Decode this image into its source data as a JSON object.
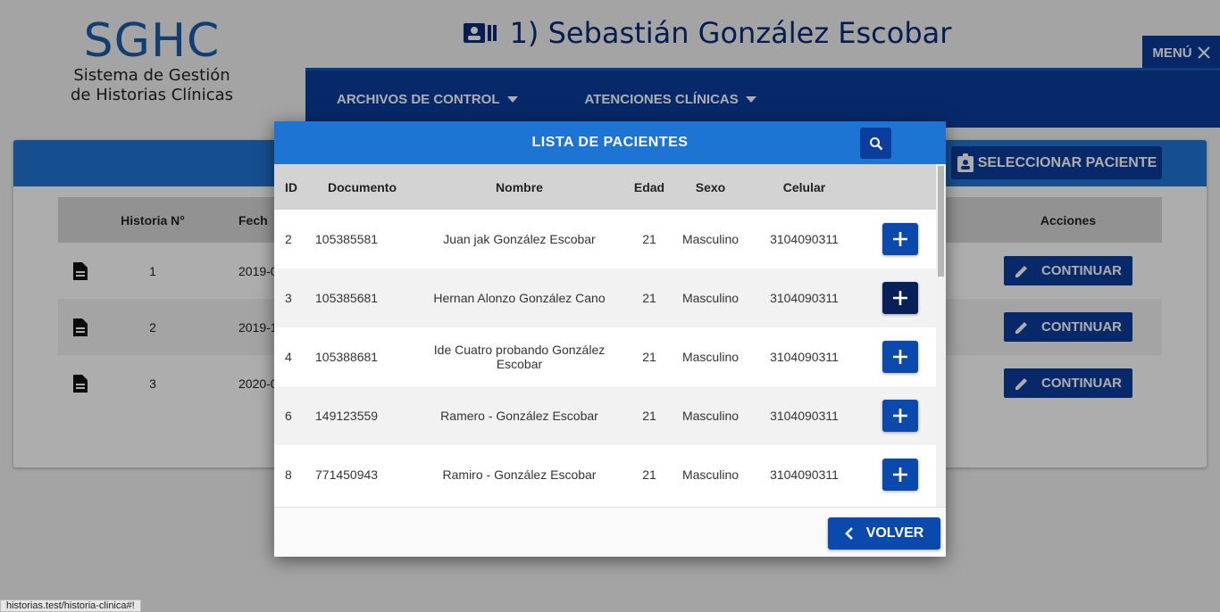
{
  "logo": {
    "title": "SGHC",
    "subtitle_line1": "Sistema de Gestión",
    "subtitle_line2": "de Historias Clínicas"
  },
  "patient_header": {
    "title": "1) Sebastián González Escobar"
  },
  "menu": {
    "label": "MENÚ"
  },
  "nav": {
    "items": [
      {
        "label": "ARCHIVOS DE CONTROL"
      },
      {
        "label": "ATENCIONES CLÍNICAS"
      }
    ]
  },
  "background_card": {
    "select_patient_label": "SELECCIONAR PACIENTE",
    "columns": {
      "historia": "Historia N°",
      "fecha": "Fech",
      "acciones": "Acciones"
    },
    "rows": [
      {
        "historia": "1",
        "fecha": "2019-0",
        "action": "CONTINUAR"
      },
      {
        "historia": "2",
        "fecha": "2019-1",
        "action": "CONTINUAR"
      },
      {
        "historia": "3",
        "fecha": "2020-0",
        "action": "CONTINUAR"
      }
    ]
  },
  "modal": {
    "title": "LISTA DE PACIENTES",
    "columns": {
      "id": "ID",
      "documento": "Documento",
      "nombre": "Nombre",
      "edad": "Edad",
      "sexo": "Sexo",
      "celular": "Celular"
    },
    "rows": [
      {
        "id": "2",
        "documento": "105385581",
        "nombre": "Juan jak González Escobar",
        "edad": "21",
        "sexo": "Masculino",
        "celular": "3104090311"
      },
      {
        "id": "3",
        "documento": "105385681",
        "nombre": "Hernan Alonzo González Cano",
        "edad": "21",
        "sexo": "Masculino",
        "celular": "3104090311"
      },
      {
        "id": "4",
        "documento": "105388681",
        "nombre": "Ide Cuatro probando González Escobar",
        "edad": "21",
        "sexo": "Masculino",
        "celular": "3104090311"
      },
      {
        "id": "6",
        "documento": "149123559",
        "nombre": "Ramero - González Escobar",
        "edad": "21",
        "sexo": "Masculino",
        "celular": "3104090311"
      },
      {
        "id": "8",
        "documento": "771450943",
        "nombre": "Ramiro - González Escobar",
        "edad": "21",
        "sexo": "Masculino",
        "celular": "3104090311"
      }
    ],
    "back_label": "VOLVER"
  },
  "statusbar": {
    "url": "historias.test/historia-clinica#!"
  },
  "colors": {
    "primary": "#0b3d9c",
    "header_blue": "#1d74d3",
    "active_button": "#07205a"
  }
}
